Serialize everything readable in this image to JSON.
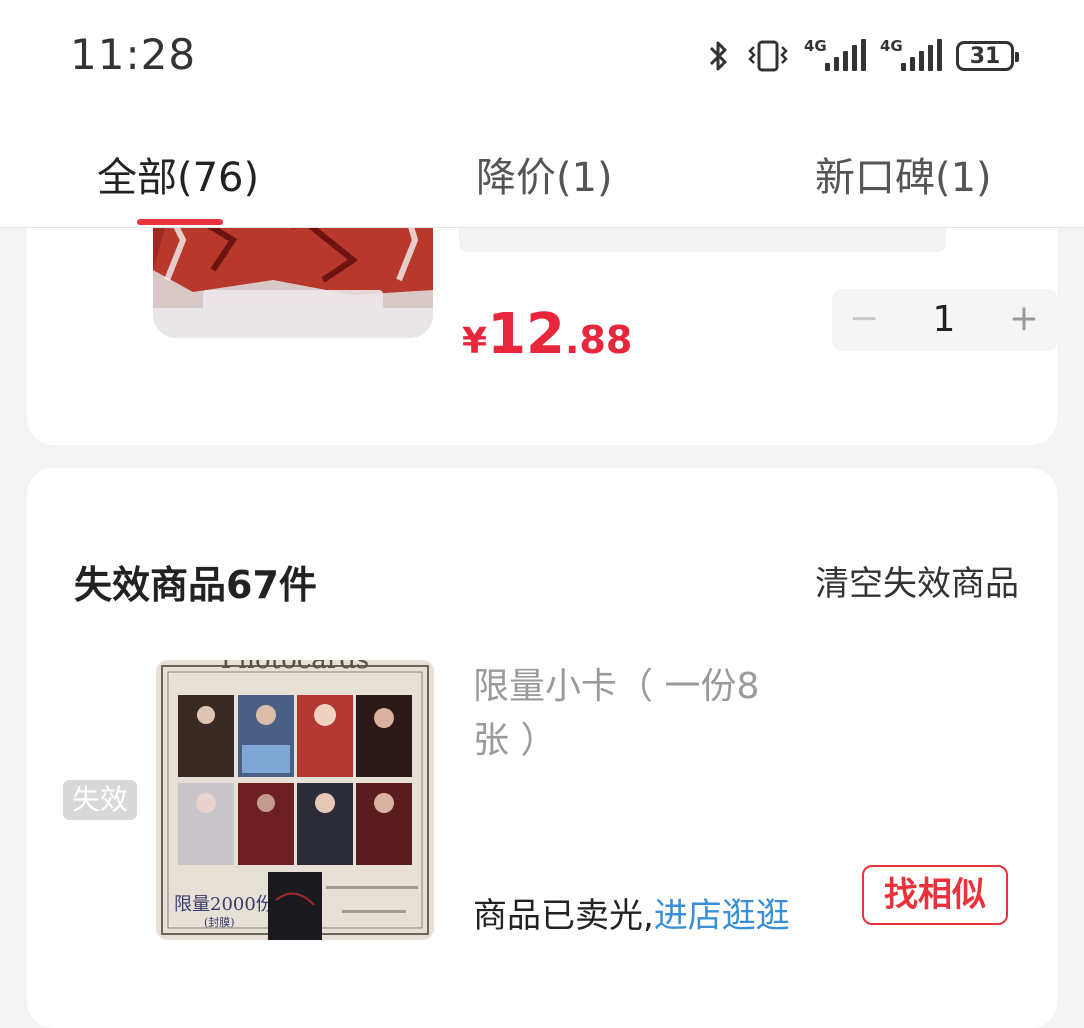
{
  "status_bar": {
    "time": "11:28",
    "signal_1_label": "4G",
    "signal_2_label": "4G",
    "battery": "31"
  },
  "tabs": [
    {
      "label": "全部(76)",
      "active": true
    },
    {
      "label": "降价(1)",
      "active": false
    },
    {
      "label": "新口碑(1)",
      "active": false
    }
  ],
  "cart_item": {
    "price_symbol": "¥",
    "price_int": "12",
    "price_dec": ".88",
    "quantity": "1",
    "minus_icon": "−",
    "plus_icon": "+"
  },
  "invalid_section": {
    "title": "失效商品67件",
    "clear_label": "清空失效商品",
    "item": {
      "badge": "失效",
      "name": "限量小卡（ 一份8张 ）",
      "sold_out_text": "商品已卖光,",
      "shop_link": "进店逛逛",
      "find_similar": "找相似",
      "image_text_1": "Photocards",
      "image_text_2": "限量2000份",
      "image_text_3": "(封膜)"
    }
  },
  "colors": {
    "accent_red": "#e8323c",
    "price_red": "#e8263c",
    "link_blue": "#3a8fd8"
  }
}
